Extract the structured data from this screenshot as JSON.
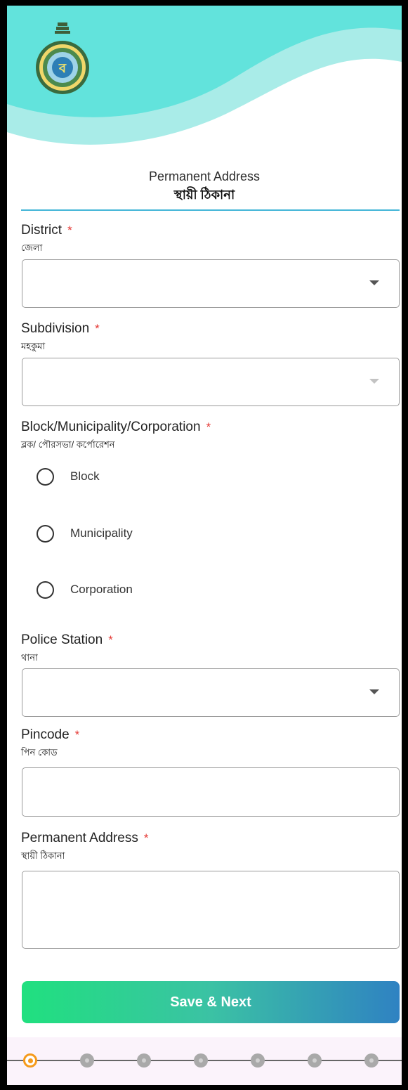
{
  "header": {
    "emblem_icon": "west-bengal-emblem-icon",
    "wave_colors": [
      "#62e3dc",
      "#a9ece8"
    ]
  },
  "section": {
    "title_en": "Permanent Address",
    "title_bn": "স্থায়ী ঠিকানা"
  },
  "fields": {
    "district": {
      "label": "District",
      "label_bn": "জেলা",
      "required": "*",
      "value": ""
    },
    "subdivision": {
      "label": "Subdivision",
      "label_bn": "মহকুমা",
      "required": "*",
      "value": ""
    },
    "block_type": {
      "label": "Block/Municipality/Corporation",
      "label_bn": "ব্লক/ পৌরসভা/ কর্পোরেশন",
      "required": "*",
      "options": [
        "Block",
        "Municipality",
        "Corporation"
      ]
    },
    "police_station": {
      "label": "Police Station",
      "label_bn": "থানা",
      "required": "*",
      "value": ""
    },
    "pincode": {
      "label": "Pincode",
      "label_bn": "পিন কোড",
      "required": "*",
      "value": ""
    },
    "address": {
      "label": "Permanent Address",
      "label_bn": "স্থায়ী ঠিকানা",
      "required": "*",
      "value": ""
    }
  },
  "actions": {
    "save_next_label": "Save & Next"
  },
  "stepper": {
    "total_steps": 7,
    "current_step": 1,
    "active_color": "#f59a1b",
    "inactive_color": "#a9a9a9"
  },
  "colors": {
    "accent_line": "#45b6d8",
    "required": "#e53935",
    "button_gradient": [
      "#20e07f",
      "#2f82c2"
    ]
  }
}
